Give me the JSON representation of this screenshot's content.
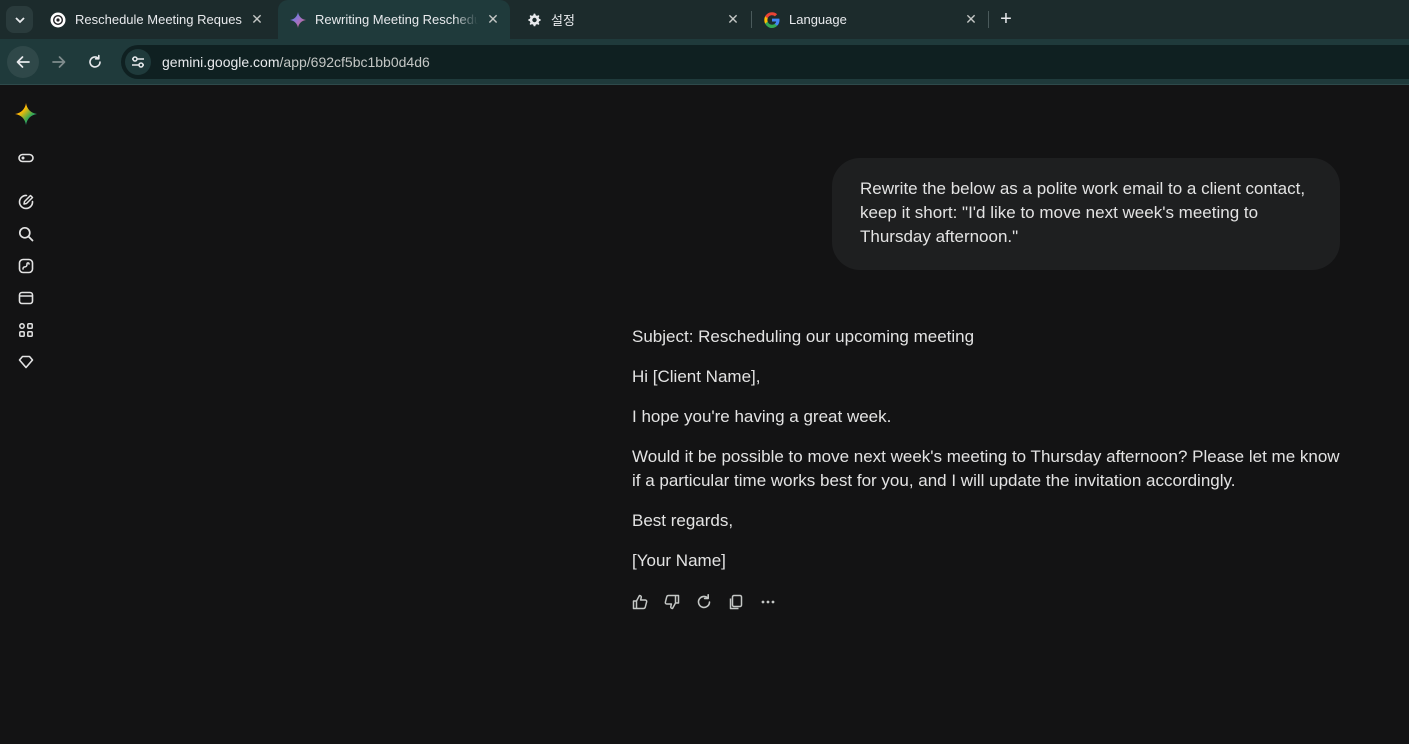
{
  "browser": {
    "tabs": [
      {
        "title": "Reschedule Meeting Request",
        "icon": "chatgpt-icon",
        "active": false
      },
      {
        "title": "Rewriting Meeting Reschedule",
        "icon": "gemini-icon",
        "active": true
      },
      {
        "title": "설정",
        "icon": "gear-icon",
        "active": false
      },
      {
        "title": "Language",
        "icon": "google-icon",
        "active": false
      }
    ],
    "close_glyph": "✕",
    "new_tab_glyph": "+",
    "url_host": "gemini.google.com",
    "url_path": "/app/692cf5bc1bb0d4d6"
  },
  "sidebar": {
    "items": [
      {
        "name": "gemini-logo-icon"
      },
      {
        "name": "toggle-sidebar-icon"
      },
      {
        "name": "new-chat-icon"
      },
      {
        "name": "search-icon"
      },
      {
        "name": "gems-icon"
      },
      {
        "name": "library-icon"
      },
      {
        "name": "apps-icon"
      },
      {
        "name": "upgrade-icon"
      }
    ]
  },
  "chat": {
    "user_message": "Rewrite the below as a polite work email to a client contact, keep it short: \"I'd like to move next week's meeting to Thursday afternoon.\"",
    "response": [
      "Subject: Rescheduling our upcoming meeting",
      "Hi [Client Name],",
      "I hope you're having a great week.",
      "Would it be possible to move next week's meeting to Thursday afternoon? Please let me know if a particular time works best for you, and I will update the invitation accordingly.",
      "Best regards,",
      "[Your Name]"
    ]
  },
  "colors": {
    "background": "#131314",
    "tabstrip": "#1c2b2c",
    "toolbar": "#1f3a3b",
    "bubble": "#1e1f20",
    "text": "#e3e3e3"
  }
}
